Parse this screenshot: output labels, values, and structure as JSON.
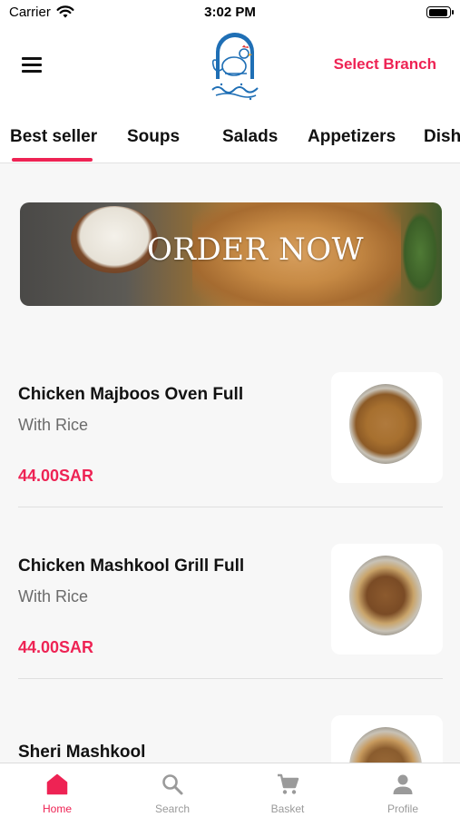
{
  "status_bar": {
    "carrier": "Carrier",
    "time": "3:02 PM",
    "battery_level": 0.95
  },
  "header": {
    "menu_icon": "hamburger-menu-icon",
    "logo": "rooster-logo",
    "select_branch": "Select Branch"
  },
  "tabs": [
    {
      "label": "Best seller",
      "active": true
    },
    {
      "label": "Soups",
      "active": false
    },
    {
      "label": "Salads",
      "active": false
    },
    {
      "label": "Appetizers",
      "active": false
    },
    {
      "label": "Dish",
      "active": false
    }
  ],
  "banner": {
    "text": "ORDER NOW"
  },
  "products": [
    {
      "name": "Chicken Majboos Oven Full",
      "description": "With Rice",
      "price": "44.00SAR"
    },
    {
      "name": "Chicken Mashkool Grill Full",
      "description": "With Rice",
      "price": "44.00SAR"
    },
    {
      "name": "Sheri Mashkool",
      "description": "",
      "price": ""
    }
  ],
  "bottom_nav": [
    {
      "label": "Home",
      "icon": "home-icon",
      "active": true
    },
    {
      "label": "Search",
      "icon": "search-icon",
      "active": false
    },
    {
      "label": "Basket",
      "icon": "cart-icon",
      "active": false
    },
    {
      "label": "Profile",
      "icon": "profile-icon",
      "active": false
    }
  ],
  "colors": {
    "accent": "#ee2354",
    "text": "#111111",
    "muted": "#6b6b6b",
    "background": "#f7f7f7"
  }
}
